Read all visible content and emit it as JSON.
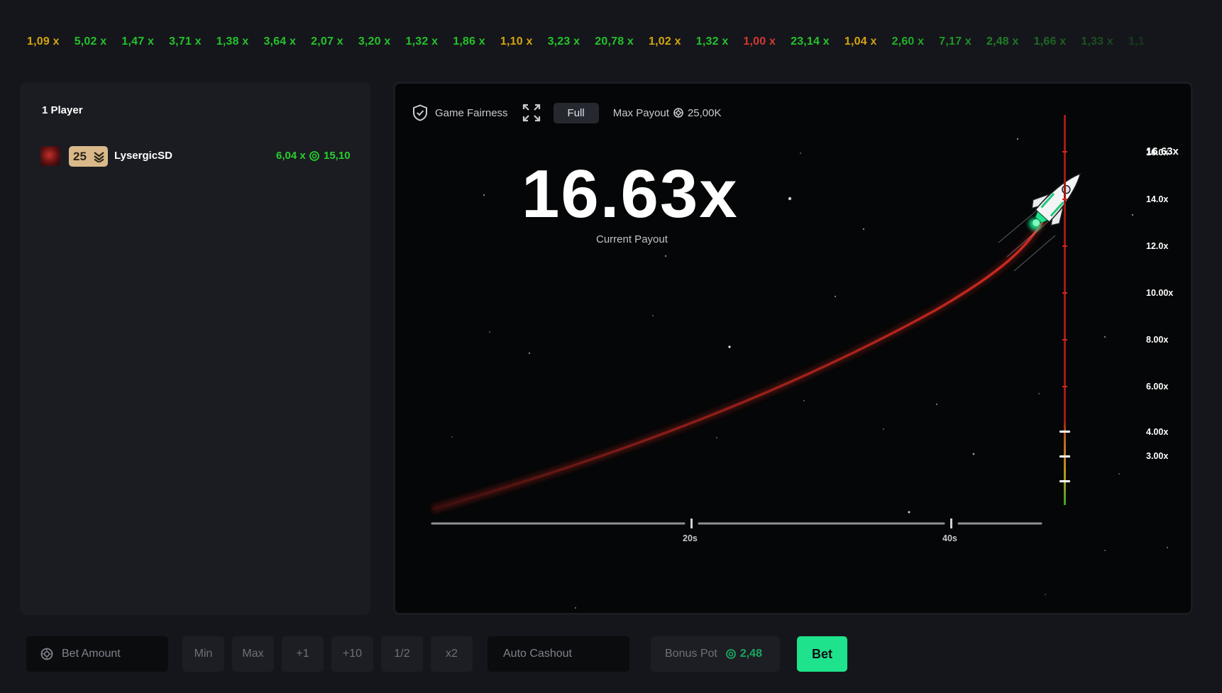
{
  "history": [
    {
      "label": "1,09 x",
      "tone": "mid"
    },
    {
      "label": "5,02 x",
      "tone": "high"
    },
    {
      "label": "1,47 x",
      "tone": "high"
    },
    {
      "label": "3,71 x",
      "tone": "high"
    },
    {
      "label": "1,38 x",
      "tone": "high"
    },
    {
      "label": "3,64 x",
      "tone": "high"
    },
    {
      "label": "2,07 x",
      "tone": "high"
    },
    {
      "label": "3,20 x",
      "tone": "high"
    },
    {
      "label": "1,32 x",
      "tone": "high"
    },
    {
      "label": "1,86 x",
      "tone": "high"
    },
    {
      "label": "1,10 x",
      "tone": "mid"
    },
    {
      "label": "3,23 x",
      "tone": "high"
    },
    {
      "label": "20,78 x",
      "tone": "high"
    },
    {
      "label": "1,02 x",
      "tone": "mid"
    },
    {
      "label": "1,32 x",
      "tone": "high"
    },
    {
      "label": "1,00 x",
      "tone": "low"
    },
    {
      "label": "23,14 x",
      "tone": "high"
    },
    {
      "label": "1,04 x",
      "tone": "mid"
    },
    {
      "label": "2,60 x",
      "tone": "high"
    },
    {
      "label": "7,17 x",
      "tone": "high"
    },
    {
      "label": "2,48 x",
      "tone": "high"
    },
    {
      "label": "1,66 x",
      "tone": "high"
    },
    {
      "label": "1,33 x",
      "tone": "high"
    },
    {
      "label": "1,1",
      "tone": "high"
    }
  ],
  "players": {
    "count_label": "1 Player",
    "rows": [
      {
        "level": "25",
        "name": "LysergicSD",
        "multiplier": "6,04 x",
        "win": "15,10"
      }
    ]
  },
  "game": {
    "fairness_label": "Game Fairness",
    "full_label": "Full",
    "max_payout_label": "Max Payout",
    "max_payout_value": "25,00K",
    "current_payout": "16.63x",
    "current_payout_caption": "Current Payout",
    "scale_current": "16.63x",
    "y_ticks": [
      "16.0x",
      "14.0x",
      "12.0x",
      "10.00x",
      "8.00x",
      "6.00x",
      "4.00x",
      "3.00x"
    ],
    "x_ticks": [
      "20s",
      "40s"
    ],
    "multiplier_value": 16.63
  },
  "controls": {
    "bet_amount_placeholder": "Bet Amount",
    "min_label": "Min",
    "max_label": "Max",
    "plus1_label": "+1",
    "plus10_label": "+10",
    "half_label": "1/2",
    "double_label": "x2",
    "auto_cashout_placeholder": "Auto Cashout",
    "bonus_pot_label": "Bonus Pot",
    "bonus_pot_value": "2,48",
    "bet_label": "Bet"
  },
  "colors": {
    "accent": "#1ee38c",
    "win": "#26d02c",
    "mid": "#d4a410",
    "loss": "#d23a30",
    "trail": "#c3271f"
  }
}
